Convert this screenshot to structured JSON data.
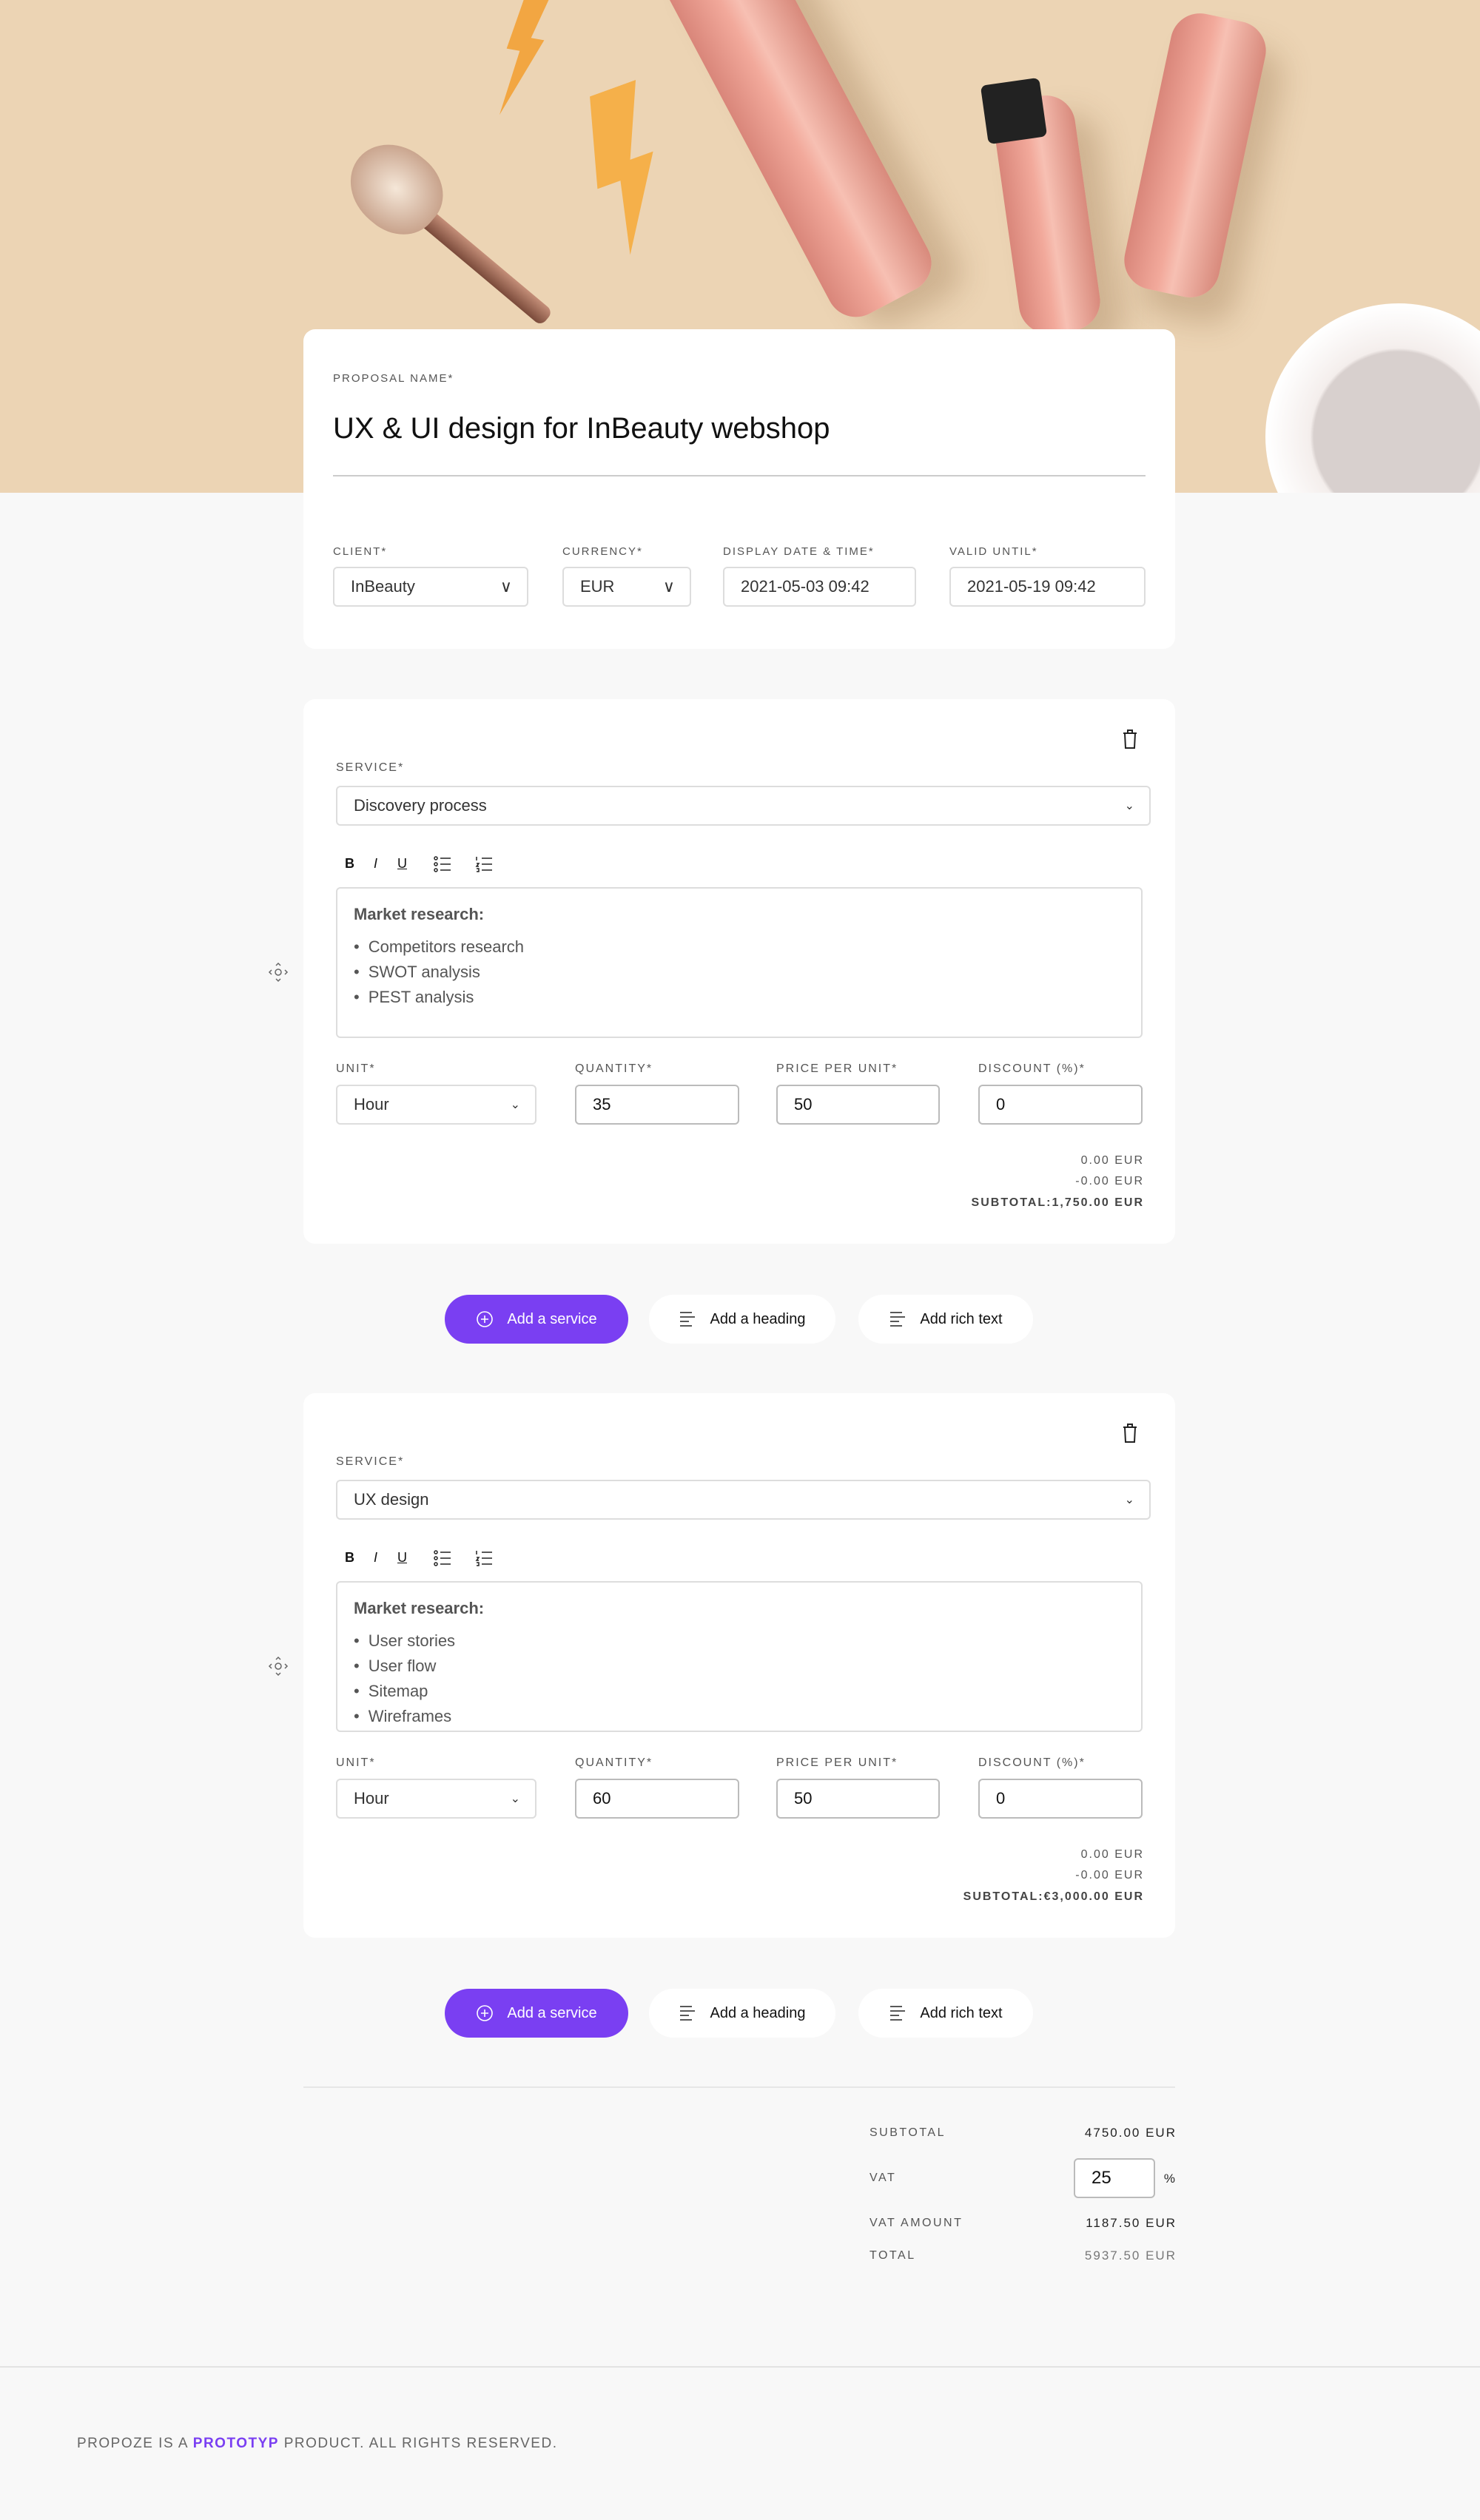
{
  "colors": {
    "accent": "#7a3ff2",
    "hero_bg": "#ecd4b4",
    "page_bg": "#f8f8f8"
  },
  "proposal": {
    "name_label": "PROPOSAL NAME*",
    "name_value": "UX & UI design for InBeauty webshop",
    "client_label": "CLIENT*",
    "client_value": "InBeauty",
    "currency_label": "CURRENCY*",
    "currency_value": "EUR",
    "display_date_label": "DISPLAY DATE & TIME*",
    "display_date_value": "2021-05-03 09:42",
    "valid_until_label": "VALID UNTIL*",
    "valid_until_value": "2021-05-19 09:42"
  },
  "toolbar": {
    "bold": "B",
    "italic": "I",
    "underline": "U"
  },
  "field_labels": {
    "service": "SERVICE*",
    "unit": "UNIT*",
    "quantity": "QUANTITY*",
    "price": "PRICE PER UNIT*",
    "discount": "DISCOUNT (%)*"
  },
  "services": [
    {
      "service": "Discovery process",
      "heading": "Market research:",
      "items": [
        "Competitors research",
        "SWOT analysis",
        "PEST analysis"
      ],
      "unit": "Hour",
      "quantity": "35",
      "price": "50",
      "discount": "0",
      "line1": "0.00 EUR",
      "line2": "-0.00 EUR",
      "subtotal": "SUBTOTAL:1,750.00 EUR"
    },
    {
      "service": "UX design",
      "heading": "Market research:",
      "items": [
        "User stories",
        "User flow",
        "Sitemap",
        "Wireframes"
      ],
      "unit": "Hour",
      "quantity": "60",
      "price": "50",
      "discount": "0",
      "line1": "0.00 EUR",
      "line2": "-0.00 EUR",
      "subtotal": "SUBTOTAL:€3,000.00 EUR"
    }
  ],
  "actions": {
    "add_service": "Add a service",
    "add_heading": "Add a heading",
    "add_rich_text": "Add rich text"
  },
  "summary": {
    "subtotal_label": "SUBTOTAL",
    "subtotal_value": "4750.00 EUR",
    "vat_label": "VAT",
    "vat_value": "25",
    "vat_unit": "%",
    "vat_amount_label": "VAT AMOUNT",
    "vat_amount_value": "1187.50 EUR",
    "total_label": "TOTAL",
    "total_value": "5937.50 EUR"
  },
  "footer": {
    "prefix": "PROPOZE IS A ",
    "brand": "PROTOTYP",
    "suffix": " PRODUCT. ALL RIGHTS RESERVED."
  }
}
